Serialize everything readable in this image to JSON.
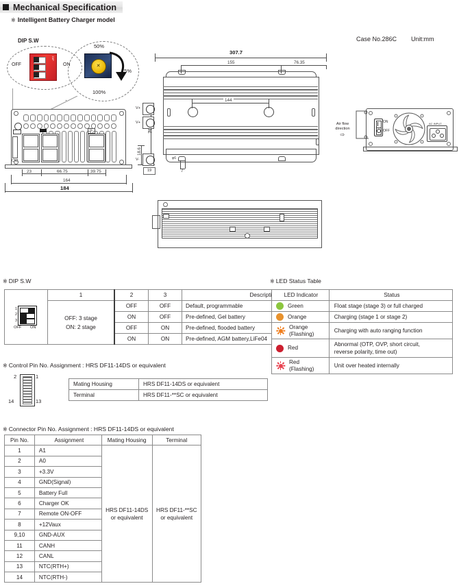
{
  "header": {
    "title": "Mechanical Specification",
    "bullet_icon": "filled-square-icon"
  },
  "subtitle": {
    "marker": "※",
    "text": "Intelligent Battery Charger model"
  },
  "case_info": {
    "case_no": "Case No.286C",
    "unit": "Unit:mm"
  },
  "dip_callout": {
    "title": "DIP S.W",
    "off_label": "OFF",
    "on_label": "ON"
  },
  "potentiometer_callout": {
    "top": "50%",
    "right": "75%",
    "bottom": "100%"
  },
  "drawing_front": {
    "dims": [
      "23",
      "66.75",
      "39.75",
      "164",
      "184",
      "70",
      "18.6"
    ],
    "labels": [
      "V+",
      "V+",
      "V-",
      "19"
    ]
  },
  "drawing_top": {
    "dims": [
      "307.7",
      "155",
      "76.35",
      "144",
      "7",
      "φ6"
    ]
  },
  "drawing_rear": {
    "airflow": "Air flow\ndirection",
    "airflow_line1": "Air flow",
    "airflow_line2": "direction",
    "ac_input": "AC INPUT"
  },
  "dip_section": {
    "marker": "※",
    "title": "DIP S.W",
    "switch_rows": [
      "1",
      "2",
      "3"
    ],
    "switch_off": "OFF",
    "switch_on": "ON",
    "headers": [
      "",
      "1",
      "2",
      "3",
      "Description"
    ],
    "stage_text_line1": "OFF: 3 stage",
    "stage_text_line2": "ON:  2 stage",
    "rows": [
      {
        "sw2": "OFF",
        "sw3": "OFF",
        "desc": "Default, programmable"
      },
      {
        "sw2": "ON",
        "sw3": "OFF",
        "desc": "Pre-defined, Gel battery"
      },
      {
        "sw2": "OFF",
        "sw3": "ON",
        "desc": "Pre-defined, flooded battery"
      },
      {
        "sw2": "ON",
        "sw3": "ON",
        "desc": "Pre-defined, AGM battery,LiFe04"
      }
    ]
  },
  "led_section": {
    "marker": "※",
    "title": "LED Status Table",
    "headers": [
      "LED Indicator",
      "Status"
    ],
    "rows": [
      {
        "label": "Green",
        "sub": "",
        "style": "solid",
        "color": "#8cc63f",
        "status": "Float stage (stage 3) or full charged"
      },
      {
        "label": "Orange",
        "sub": "",
        "style": "solid",
        "color": "#e8922e",
        "status": "Charging (stage 1 or stage 2)"
      },
      {
        "label": "Orange",
        "sub": "(Flashing)",
        "style": "flash",
        "color": "#f07e1e",
        "status": "Charging with auto ranging function"
      },
      {
        "label": "Red",
        "sub": "",
        "style": "solid",
        "color": "#cc1f2f",
        "status": "Abnormal (OTP, OVP, short circuit,\nreverse polarity, time out)"
      },
      {
        "label": "Red",
        "sub": "(Flashing)",
        "style": "flash",
        "color": "#e8414f",
        "status": "Unit over heated internally"
      }
    ]
  },
  "control_pin_section": {
    "marker": "※",
    "title": "Control Pin No. Assignment : HRS DF11-14DS or equivalent",
    "connector_pins": [
      "2",
      "1",
      "14",
      "13"
    ],
    "rows": [
      {
        "label": "Mating Housing",
        "value": "HRS DF11-14DS or equivalent"
      },
      {
        "label": "Terminal",
        "value": "HRS DF11-**SC or equivalent"
      }
    ]
  },
  "connector_pin_section": {
    "marker": "※",
    "title": "Connector Pin No. Assignment : HRS DF11-14DS or equivalent",
    "headers": [
      "Pin No.",
      "Assignment",
      "Mating Housing",
      "Terminal"
    ],
    "mating_housing": "HRS DF11-14DS\nor equivalent",
    "mating_housing_l1": "HRS DF11-14DS",
    "mating_housing_l2": "or equivalent",
    "terminal": "HRS DF11-**SC\nor equivalent",
    "terminal_l1": "HRS DF11-**SC",
    "terminal_l2": "or equivalent",
    "rows": [
      {
        "pin": "1",
        "assignment": "A1"
      },
      {
        "pin": "2",
        "assignment": "A0"
      },
      {
        "pin": "3",
        "assignment": "+3.3V"
      },
      {
        "pin": "4",
        "assignment": "GND(Signal)"
      },
      {
        "pin": "5",
        "assignment": "Battery Full"
      },
      {
        "pin": "6",
        "assignment": "Charger OK"
      },
      {
        "pin": "7",
        "assignment": "Remote ON-OFF"
      },
      {
        "pin": "8",
        "assignment": "+12Vaux"
      },
      {
        "pin": "9,10",
        "assignment": "GND-AUX"
      },
      {
        "pin": "11",
        "assignment": "CANH"
      },
      {
        "pin": "12",
        "assignment": "CANL"
      },
      {
        "pin": "13",
        "assignment": "NTC(RTH+)"
      },
      {
        "pin": "14",
        "assignment": "NTC(RTH-)"
      }
    ]
  }
}
